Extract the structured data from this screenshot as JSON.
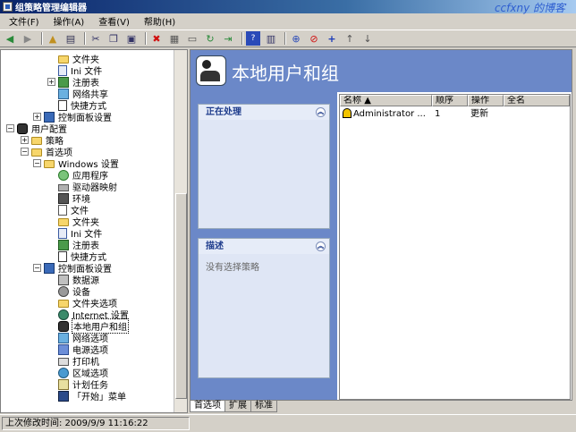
{
  "window": {
    "title": "组策略管理编辑器",
    "watermark": "ccfxny 的博客"
  },
  "menu": [
    {
      "label": "文件(F)"
    },
    {
      "label": "操作(A)"
    },
    {
      "label": "查看(V)"
    },
    {
      "label": "帮助(H)"
    }
  ],
  "tree": {
    "items": [
      {
        "label": "文件夹",
        "icon": "folder-icon"
      },
      {
        "label": "Ini 文件",
        "icon": "ini-file-icon"
      },
      {
        "label": "注册表",
        "icon": "registry-icon"
      },
      {
        "label": "网络共享",
        "icon": "network-share-icon"
      },
      {
        "label": "快捷方式",
        "icon": "shortcut-icon"
      },
      {
        "label": "控制面板设置",
        "icon": "control-panel-icon"
      },
      {
        "label": "用户配置",
        "icon": "user-config-icon"
      },
      {
        "label": "策略",
        "icon": "folder-icon"
      },
      {
        "label": "首选项",
        "icon": "folder-icon"
      },
      {
        "label": "Windows 设置",
        "icon": "folder-icon"
      },
      {
        "label": "应用程序",
        "icon": "application-icon"
      },
      {
        "label": "驱动器映射",
        "icon": "drive-icon"
      },
      {
        "label": "环境",
        "icon": "environment-icon"
      },
      {
        "label": "文件",
        "icon": "file-icon"
      },
      {
        "label": "文件夹",
        "icon": "folder-icon"
      },
      {
        "label": "Ini 文件",
        "icon": "ini-file-icon"
      },
      {
        "label": "注册表",
        "icon": "registry-icon"
      },
      {
        "label": "快捷方式",
        "icon": "shortcut-icon"
      },
      {
        "label": "控制面板设置",
        "icon": "control-panel-icon"
      },
      {
        "label": "数据源",
        "icon": "data-source-icon"
      },
      {
        "label": "设备",
        "icon": "device-icon"
      },
      {
        "label": "文件夹选项",
        "icon": "folder-options-icon"
      },
      {
        "label": "Internet 设置",
        "icon": "internet-icon"
      },
      {
        "label": "本地用户和组",
        "icon": "users-icon"
      },
      {
        "label": "网络选项",
        "icon": "network-options-icon"
      },
      {
        "label": "电源选项",
        "icon": "power-icon"
      },
      {
        "label": "打印机",
        "icon": "printer-icon"
      },
      {
        "label": "区域选项",
        "icon": "region-icon"
      },
      {
        "label": "计划任务",
        "icon": "task-icon"
      },
      {
        "label": "「开始」菜单",
        "icon": "start-menu-icon"
      }
    ],
    "selected": "本地用户和组"
  },
  "right": {
    "title": "本地用户和组",
    "panel_processing": {
      "title": "正在处理"
    },
    "panel_description": {
      "title": "描述",
      "text": "没有选择策略"
    },
    "columns": [
      "名称",
      "顺序",
      "操作",
      "全名"
    ],
    "rows": [
      {
        "name": "Administrator ...",
        "order": "1",
        "action": "更新",
        "fullname": ""
      }
    ]
  },
  "tabs": [
    {
      "label": "首选项",
      "active": true
    },
    {
      "label": "扩展",
      "active": false
    },
    {
      "label": "标准",
      "active": false
    }
  ],
  "status": {
    "text": "上次修改时间: 2009/9/9 11:16:22"
  },
  "colors": {
    "accent": "#6b88c8",
    "title_bar": "#0a246a"
  }
}
